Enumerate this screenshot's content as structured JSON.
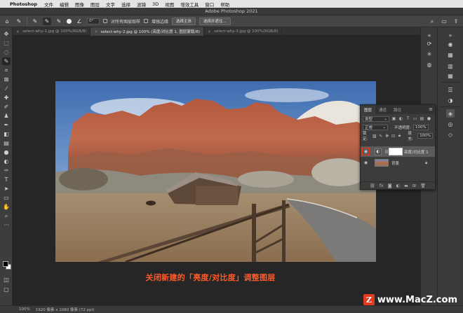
{
  "menubar": {
    "app_name": "Photoshop",
    "items": [
      "文件",
      "编辑",
      "图像",
      "图层",
      "文字",
      "选择",
      "滤镜",
      "3D",
      "视图",
      "增效工具",
      "窗口",
      "帮助"
    ]
  },
  "window": {
    "title": "Adobe Photoshop 2021"
  },
  "options": {
    "size_value": "0°",
    "sample_all_layers": "对所有图层取样",
    "enhance_edge": "增强边缘",
    "select_subject": "选择主体",
    "select_and_mask": "选择并遮住..."
  },
  "tabs": [
    {
      "label": "select-why-1.jpg @ 100%(RGB/8)",
      "active": false
    },
    {
      "label": "select-why-2.jpg @ 100% (亮度/对比度 1, 图层蒙版/8)",
      "active": true
    },
    {
      "label": "select-why-3.jpg @ 100%(RGB/8)",
      "active": false
    }
  ],
  "layers_panel": {
    "tabs": [
      "图层",
      "通道",
      "路径"
    ],
    "filter_kind": "类型",
    "blend_mode": "正常",
    "opacity_label": "不透明度:",
    "opacity_value": "100%",
    "lock_label": "锁定:",
    "fill_label": "填充:",
    "fill_value": "100%",
    "layers": [
      {
        "name": "亮度/对比度 1",
        "selected": true,
        "visible_highlighted": true
      },
      {
        "name": "背景",
        "selected": false,
        "visible_highlighted": false
      }
    ],
    "footer_icons": [
      "link-icon",
      "fx-icon",
      "mask-icon",
      "adjustment-icon",
      "folder-icon",
      "new-layer-icon",
      "trash-icon"
    ]
  },
  "caption": "关闭新建的「亮度/对比度」调整图层",
  "status": {
    "zoom": "100%",
    "doc_info": "1920 像素 x 1080 像素 (72 ppi)"
  },
  "watermark": {
    "logo": "Z",
    "text": "www.MacZ.com"
  },
  "colors": {
    "highlight": "#e8321f",
    "caption": "#ff5a2a",
    "panel_bg": "#3c3c3c",
    "canvas_bg": "#262626"
  }
}
